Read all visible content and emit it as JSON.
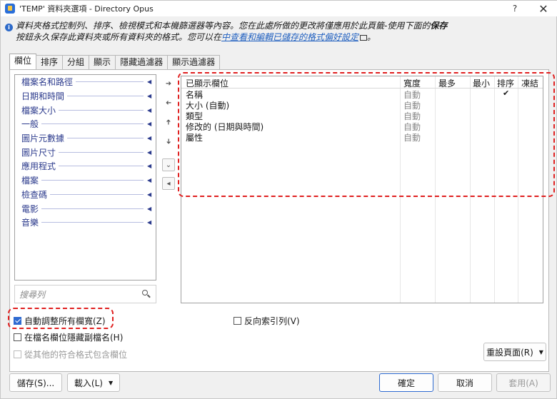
{
  "window": {
    "title": "'TEMP' 資料夾選項 - Directory Opus",
    "help_label": "?",
    "close_label": "✕"
  },
  "info": {
    "text1": "資料夾格式控制列、排序、檢視模式和本機篩選器等內容。您在此處所做的更改將僅應用於此頁籤-使用下面的",
    "bold": "保存",
    "text2": "按鈕永久保存此資料夾或所有資料夾的格式。您可以在",
    "link": "中查看和編輯已儲存的格式偏好設定",
    "text3": "。"
  },
  "tabs": [
    "欄位",
    "排序",
    "分組",
    "顯示",
    "隱藏過濾器",
    "顯示過濾器"
  ],
  "fields": [
    "檔案名和路徑",
    "日期和時間",
    "檔案大小",
    "一般",
    "圖片元數據",
    "圖片尺寸",
    "應用程式",
    "檔案",
    "檢查碼",
    "電影",
    "音樂"
  ],
  "search": {
    "placeholder": "搜尋列"
  },
  "table": {
    "headers": {
      "name": "已顯示欄位",
      "width": "寬度",
      "max": "最多",
      "min": "最小",
      "sort": "排序",
      "freeze": "凍結"
    },
    "rows": [
      {
        "name": "名稱",
        "width": "自動",
        "sort": "✔"
      },
      {
        "name": "大小 (自動)",
        "width": "自動",
        "sort": ""
      },
      {
        "name": "類型",
        "width": "自動",
        "sort": ""
      },
      {
        "name": "修改的 (日期與時間)",
        "width": "自動",
        "sort": ""
      },
      {
        "name": "屬性",
        "width": "自動",
        "sort": ""
      }
    ]
  },
  "options": {
    "auto_size": "自動調整所有欄寬(Z)",
    "hide_ext": "在檔名欄位隱藏副檔名(H)",
    "include_other": "從其他的符合格式包含欄位",
    "reverse_index": "反向索引列(V)"
  },
  "buttons": {
    "reset": "重設頁面(R)",
    "save": "儲存(S)...",
    "load": "載入(L)",
    "ok": "確定",
    "cancel": "取消",
    "apply": "套用(A)"
  }
}
